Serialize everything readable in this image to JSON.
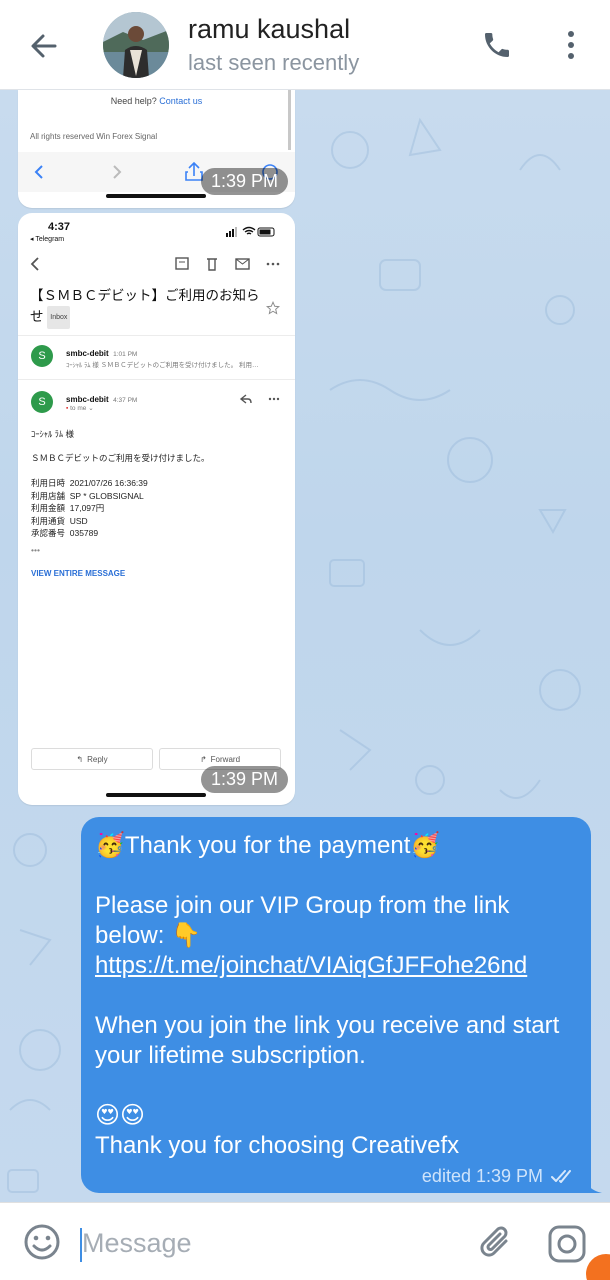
{
  "header": {
    "contact_name": "ramu kaushal",
    "status": "last seen recently",
    "icons": {
      "back": "back-arrow-icon",
      "call": "phone-icon",
      "menu": "more-vertical-icon"
    }
  },
  "messages": {
    "image1": {
      "help_text": "Need help?",
      "help_link": "Contact us",
      "rights_text": "All rights reserved Win Forex Signal",
      "time": "1:39 PM"
    },
    "image2": {
      "status_time": "4:37",
      "status_app": "◂ Telegram",
      "subject": "【ＳＭＢＣデビット】ご利用のお知らせ",
      "inbox_label": "Inbox",
      "mail1": {
        "avatar": "S",
        "sender": "smbc-debit",
        "time": "1:01 PM",
        "preview": "ｺｰｼｬﾙ ﾗﾑ 様 ＳＭＢＣデビットのご利用を受け付けました。 利用…"
      },
      "mail2": {
        "avatar": "S",
        "sender": "smbc-debit",
        "time": "4:37 PM",
        "to": "to me"
      },
      "greeting": "ｺｰｼｬﾙ ﾗﾑ 様",
      "intro": "ＳＭＢＣデビットのご利用を受け付けました。",
      "details": [
        {
          "label": "利用日時",
          "value": "2021/07/26 16:36:39"
        },
        {
          "label": "利用店舗",
          "value": "SP * GLOBSIGNAL"
        },
        {
          "label": "利用金額",
          "value": "17,097円"
        },
        {
          "label": "利用通貨",
          "value": "USD"
        },
        {
          "label": "承認番号",
          "value": "035789"
        }
      ],
      "ellipsis": "•••",
      "view_entire": "VIEW ENTIRE MESSAGE",
      "reply_label": "Reply",
      "forward_label": "Forward",
      "time": "1:39 PM"
    },
    "text_message": {
      "line1": "🥳Thank you for the payment🥳",
      "line2": "Please join our VIP Group from the link below: 👇",
      "link": "https://t.me/joinchat/VIAiqGfJFFohe26nd",
      "line3": "When you join the link you receive and start your lifetime subscription.",
      "emojis": "😍😍",
      "line4": "Thank you for choosing Creativefx",
      "edited_time": "edited 1:39 PM",
      "read_icon": "double-check-icon"
    }
  },
  "input": {
    "placeholder": "Message",
    "value": "",
    "icons": {
      "emoji": "emoji-icon",
      "attach": "paperclip-icon",
      "camera": "camera-icon"
    }
  },
  "colors": {
    "outgoing_bubble": "#3e8ee4",
    "chat_background": "#c8dbee",
    "mail_avatar": "#2e9a4b",
    "link_blue": "#2a6fd6"
  }
}
